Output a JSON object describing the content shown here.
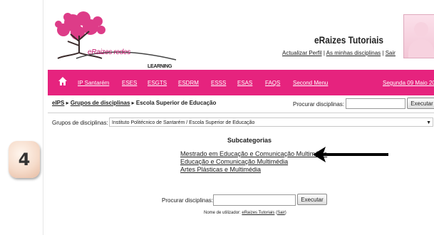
{
  "step_badge": {
    "number": "4"
  },
  "header": {
    "logo_text": "eRaizes redes",
    "logo_subtext": "LEARNING",
    "site_title": "eRaizes Tutoriais",
    "user_links": [
      {
        "label": "Actualizar Perfil"
      },
      {
        "label": "As minhas disciplinas"
      },
      {
        "label": "Sair"
      }
    ],
    "separator": "|"
  },
  "navbar": {
    "accent_color": "#e6237e",
    "home_icon": "home-icon",
    "items": [
      {
        "label": "IP Santarém"
      },
      {
        "label": "ESES"
      },
      {
        "label": "ESGTS"
      },
      {
        "label": "ESDRM"
      },
      {
        "label": "ESSS"
      },
      {
        "label": "ESAS"
      },
      {
        "label": "FAQS"
      },
      {
        "label": "Second Menu"
      }
    ],
    "date": "Segunda 09 Maio 2011"
  },
  "breadcrumb": {
    "items": [
      {
        "label": "eIPS"
      },
      {
        "label": "Grupos de disciplinas"
      }
    ],
    "separator": "▸",
    "current": "Escola Superior de Educação"
  },
  "search_top": {
    "label": "Procurar disciplinas:",
    "value": "",
    "button": "Executar"
  },
  "group": {
    "label": "Grupos de disciplinas:",
    "selected": "Instituto Politécnico de Santarém / Escola Superior de Educação"
  },
  "subcategories": {
    "title": "Subcategorias",
    "items": [
      {
        "label": "Mestrado em Educação e Comunicação Multimédia"
      },
      {
        "label": "Educação e Comunicação Multimédia"
      },
      {
        "label": "Artes Plásticas e Multimédia"
      }
    ]
  },
  "search_bottom": {
    "label": "Procurar disciplinas:",
    "value": "",
    "button": "Executar"
  },
  "footer": {
    "prefix": "Nome de utilizador:",
    "username": "eRaizes Tutoriais",
    "logout": "Sair",
    "open_paren": "(",
    "close_paren": ")"
  }
}
